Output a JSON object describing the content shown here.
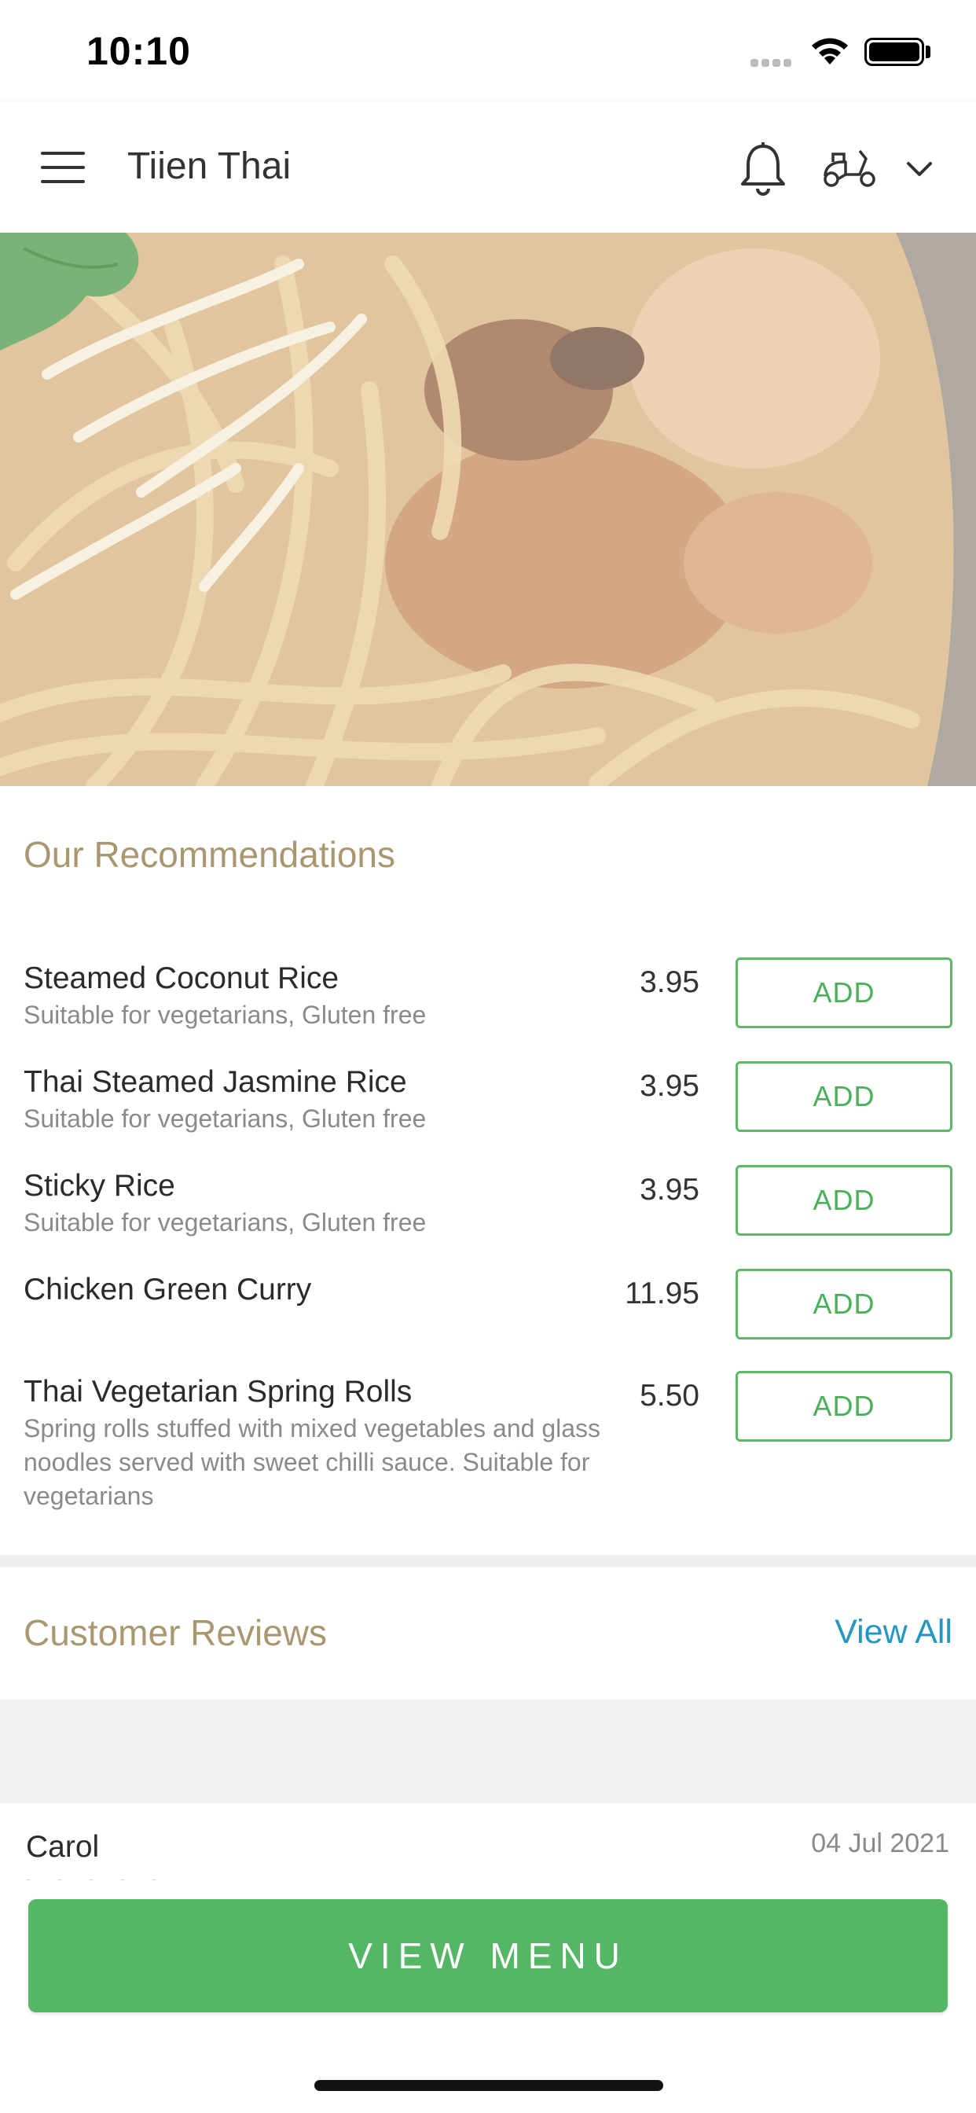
{
  "status_bar": {
    "time": "10:10"
  },
  "header": {
    "title": "Tiien Thai",
    "icons": [
      "hamburger-menu-icon",
      "bell-icon",
      "scooter-icon",
      "chevron-down-icon"
    ]
  },
  "hero": {
    "image": "noodles-dish-photo"
  },
  "recommendations": {
    "title": "Our Recommendations",
    "items": [
      {
        "name": "Steamed Coconut Rice",
        "description": "Suitable for vegetarians, Gluten free",
        "price": "3.95",
        "button": "ADD"
      },
      {
        "name": "Thai Steamed Jasmine Rice",
        "description": "Suitable for vegetarians, Gluten free",
        "price": "3.95",
        "button": "ADD"
      },
      {
        "name": "Sticky Rice",
        "description": "Suitable for vegetarians, Gluten free",
        "price": "3.95",
        "button": "ADD"
      },
      {
        "name": "Chicken Green Curry",
        "description": "",
        "price": "11.95",
        "button": "ADD"
      },
      {
        "name": "Thai Vegetarian Spring Rolls",
        "description": "Spring rolls stuffed with mixed vegetables and glass noodles served with sweet chilli sauce. Suitable for vegetarians",
        "price": "5.50",
        "button": "ADD"
      }
    ]
  },
  "reviews": {
    "title": "Customer Reviews",
    "view_all": "View All",
    "first": {
      "name": "Carol",
      "date": "04 Jul 2021"
    }
  },
  "cta": {
    "label": "VIEW MENU"
  },
  "colors": {
    "accent_green": "#55b765",
    "section_title": "#a8976f",
    "link_blue": "#2596c4"
  }
}
